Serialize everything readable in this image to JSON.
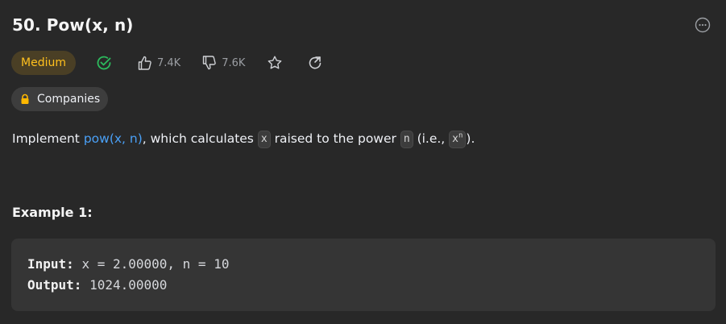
{
  "problem": {
    "title": "50. Pow(x, n)",
    "difficulty": "Medium",
    "likes": "7.4K",
    "dislikes": "7.6K",
    "companies_label": "Companies"
  },
  "description": {
    "prefix": "Implement ",
    "link_text": "pow(x, n)",
    "middle1": ", which calculates ",
    "code_x": "x",
    "middle2": " raised to the power ",
    "code_n": "n",
    "middle3": " (i.e., ",
    "power_base": "x",
    "power_exp": "n",
    "suffix": ")."
  },
  "example": {
    "title": "Example 1:",
    "input_label": "Input:",
    "input_value": "x = 2.00000, n = 10",
    "output_label": "Output:",
    "output_value": "1024.00000"
  },
  "colors": {
    "background": "#282828",
    "medium": "#ffc01e",
    "link": "#4aa0f6",
    "solved": "#2cbb5d"
  },
  "icons": [
    "more-icon",
    "solved-check-icon",
    "thumbs-up-icon",
    "thumbs-down-icon",
    "star-icon",
    "share-icon",
    "lock-icon"
  ]
}
